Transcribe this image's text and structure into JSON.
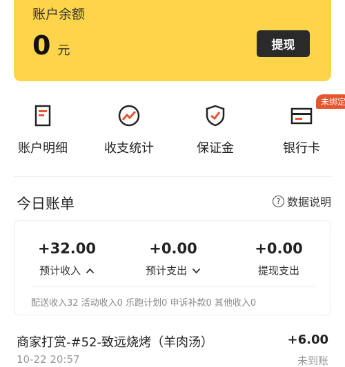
{
  "balance": {
    "label": "账户余额",
    "value": "0",
    "unit": "元",
    "withdraw_label": "提现"
  },
  "quick_actions": [
    {
      "label": "账户明细",
      "icon": "document-icon"
    },
    {
      "label": "收支统计",
      "icon": "chart-icon"
    },
    {
      "label": "保证金",
      "icon": "shield-icon"
    },
    {
      "label": "银行卡",
      "icon": "card-icon",
      "badge": "未绑定"
    }
  ],
  "today_bill": {
    "title": "今日账单",
    "explain_label": "数据说明",
    "stats": [
      {
        "value": "+32.00",
        "label": "预计收入"
      },
      {
        "value": "+0.00",
        "label": "预计支出"
      },
      {
        "value": "+0.00",
        "label": "提现支出"
      }
    ],
    "breakdown": "配送收入32 活动收入0 乐跑计划0 申诉补款0 其他收入0"
  },
  "transaction": {
    "title": "商家打赏-#52-致远烧烤（羊肉汤）",
    "amount": "+6.00",
    "time": "10-22 20:57",
    "status": "未到账"
  },
  "colors": {
    "brand_yellow": "#fdd44a",
    "accent_red": "#e8542e",
    "dark_button": "#2a2a2a"
  }
}
